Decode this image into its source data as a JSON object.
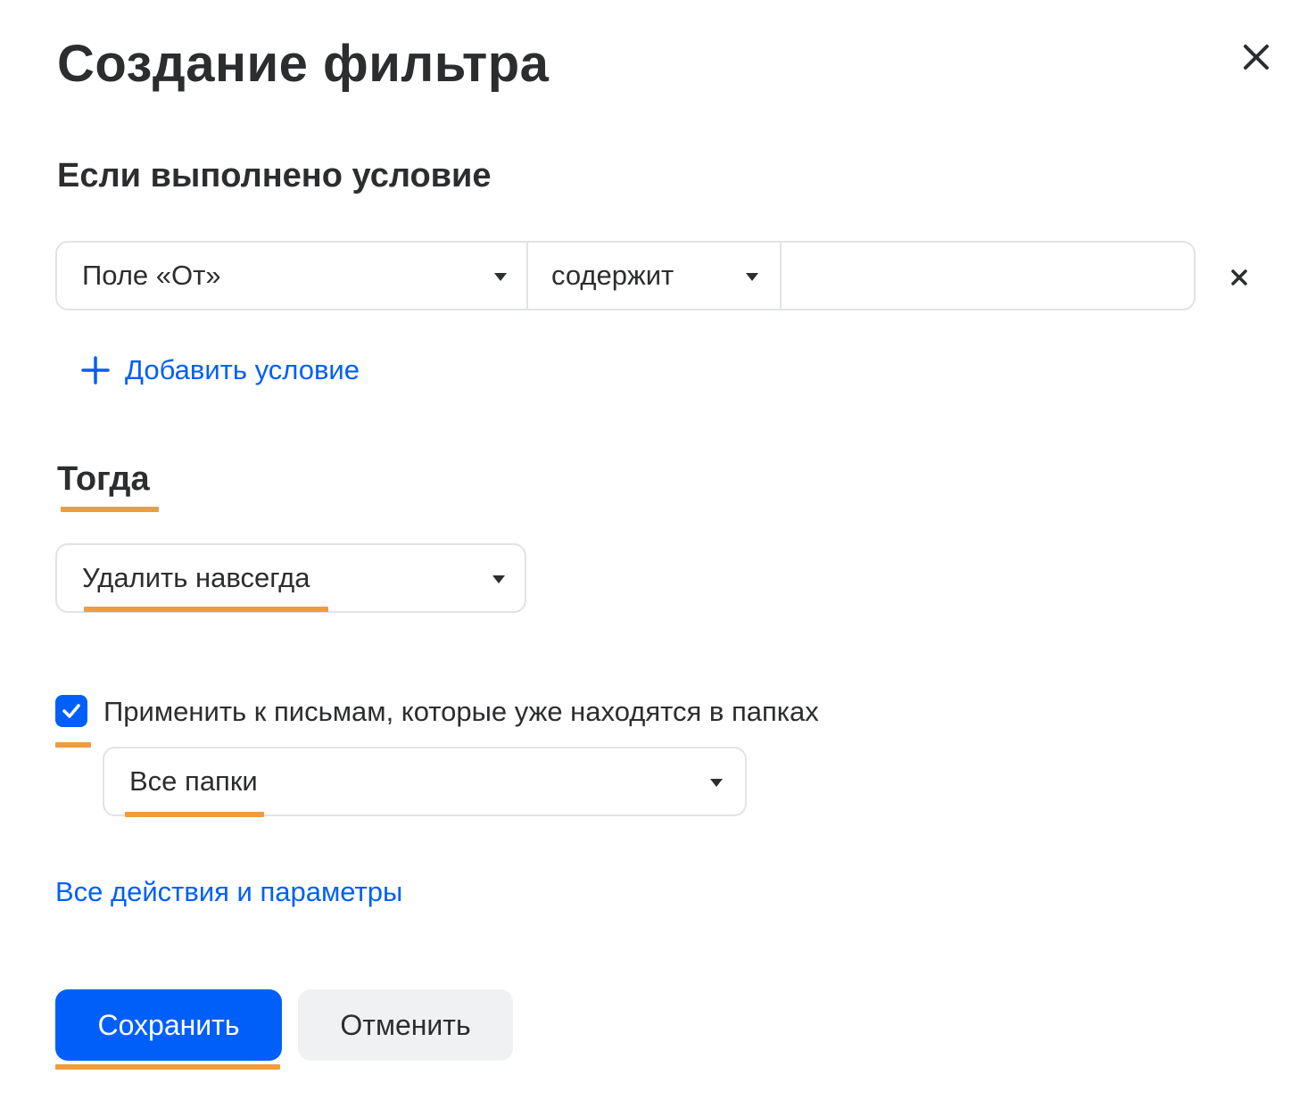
{
  "dialog": {
    "title": "Создание фильтра",
    "close_icon": "close-icon"
  },
  "conditions": {
    "heading": "Если выполнено условие",
    "rows": [
      {
        "field": "Поле «От»",
        "operator": "содержит",
        "value": ""
      }
    ],
    "remove_icon": "close-small-icon",
    "add_label": "Добавить условие",
    "add_icon": "plus-icon"
  },
  "actions": {
    "heading": "Тогда",
    "selected_action": "Удалить навсегда",
    "apply_existing": {
      "checked": true,
      "label": "Применить к письмам, которые уже находятся в папках",
      "folder": "Все папки"
    },
    "all_actions_link": "Все действия и параметры"
  },
  "footer": {
    "save_label": "Сохранить",
    "cancel_label": "Отменить"
  },
  "colors": {
    "accent": "#005ff9",
    "highlight_underline": "#f09b3c",
    "text": "#2c2d2e",
    "border": "#e2e3e5",
    "secondary_button": "#f0f1f3"
  }
}
